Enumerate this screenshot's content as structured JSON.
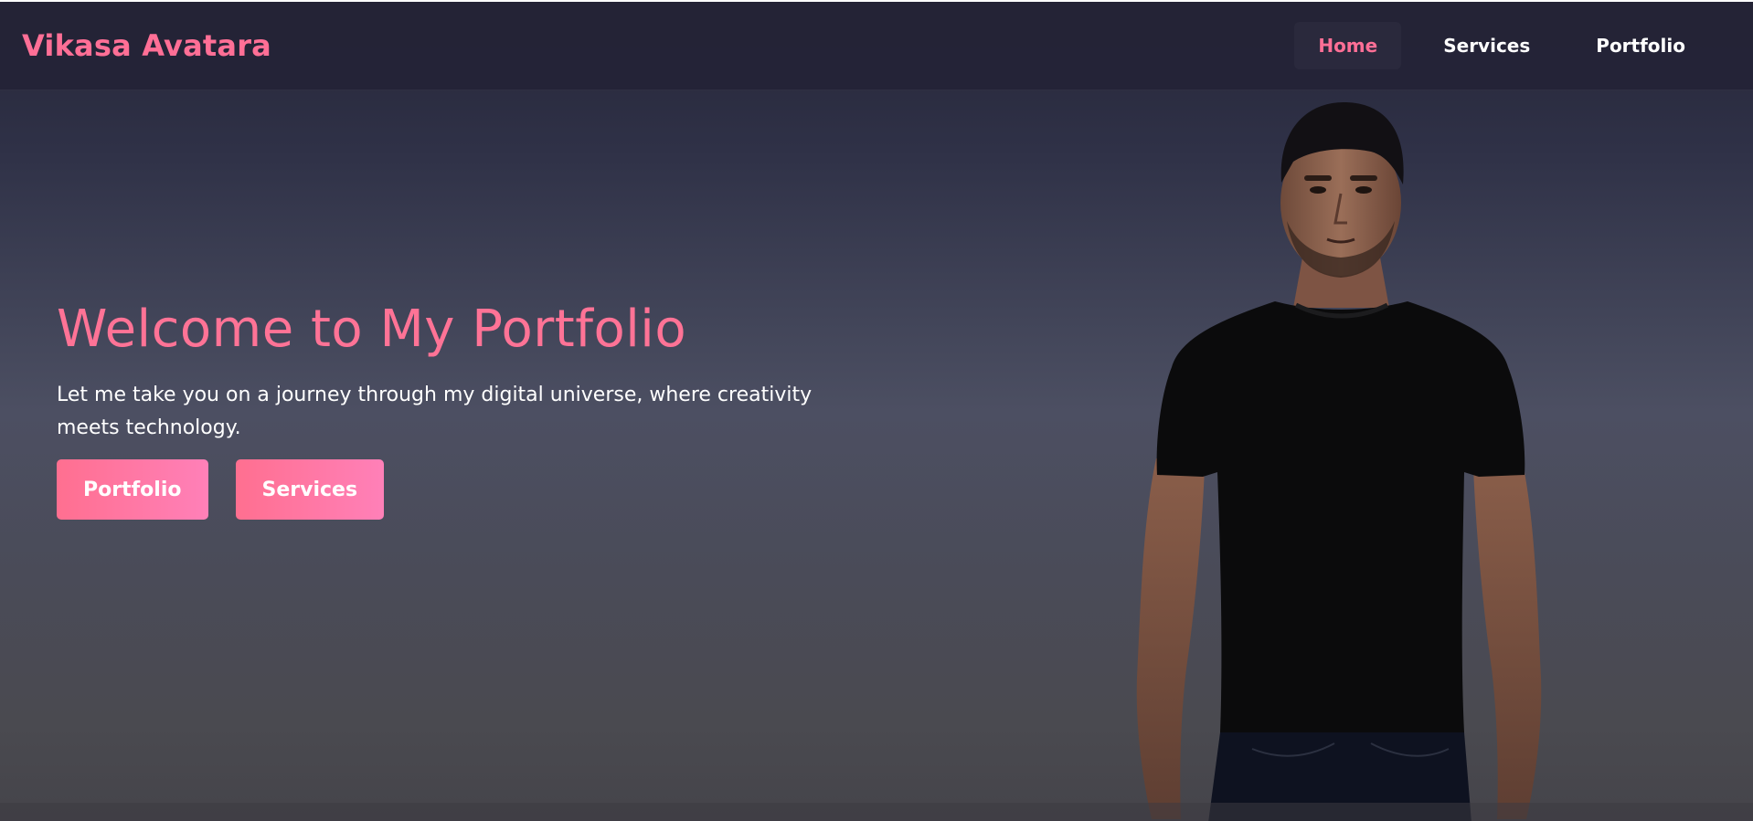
{
  "brand": {
    "name": "Vikasa Avatara"
  },
  "nav": {
    "items": [
      {
        "label": "Home",
        "active": true
      },
      {
        "label": "Services",
        "active": false
      },
      {
        "label": "Portfolio",
        "active": false
      }
    ]
  },
  "hero": {
    "title": "Welcome to My Portfolio",
    "subtitle": "Let me take you on a journey through my digital universe, where creativity meets technology.",
    "buttons": [
      {
        "label": "Portfolio"
      },
      {
        "label": "Services"
      }
    ]
  },
  "colors": {
    "accent": "#ff6f96",
    "text": "#ffffff",
    "navbar_bg": "#242336"
  },
  "avatar": {
    "icon": "person-avatar-icon"
  }
}
